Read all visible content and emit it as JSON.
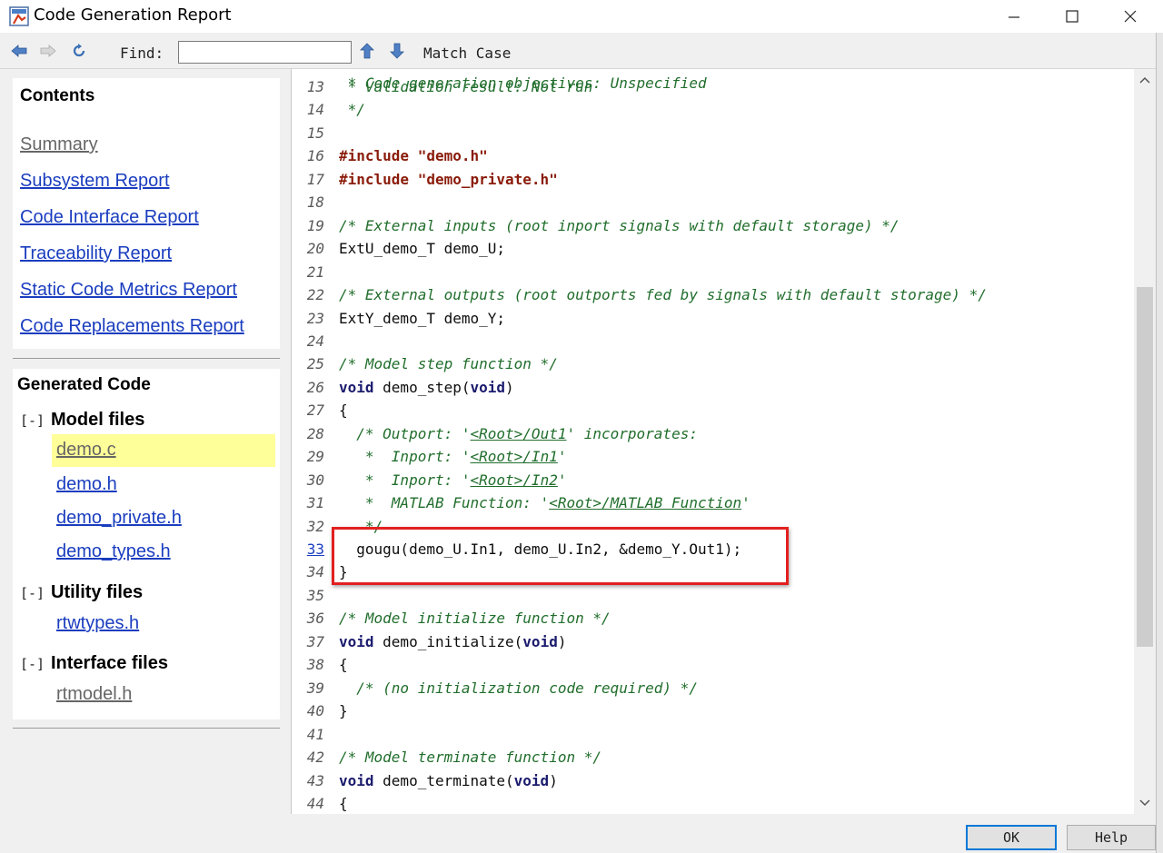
{
  "window": {
    "title": "Code Generation Report"
  },
  "toolbar": {
    "find_label": "Find:",
    "find_value": "",
    "match_case_label": "Match Case"
  },
  "contents": {
    "heading": "Contents",
    "links": [
      {
        "label": "Summary",
        "visited": true
      },
      {
        "label": "Subsystem Report",
        "visited": false
      },
      {
        "label": "Code Interface Report",
        "visited": false
      },
      {
        "label": "Traceability Report",
        "visited": false
      },
      {
        "label": "Static Code Metrics Report",
        "visited": false
      },
      {
        "label": "Code Replacements Report",
        "visited": false
      }
    ]
  },
  "generated": {
    "heading": "Generated Code",
    "groups": [
      {
        "toggle": "[-]",
        "label": "Model files",
        "files": [
          "demo.c",
          "demo.h",
          "demo_private.h",
          "demo_types.h"
        ]
      },
      {
        "toggle": "[-]",
        "label": "Utility files",
        "files": [
          "rtwtypes.h"
        ]
      },
      {
        "toggle": "[-]",
        "label": "Interface files",
        "files": [
          "rtmodel.h"
        ]
      }
    ],
    "selected_file": "demo.c"
  },
  "code_lines": [
    {
      "n": "13",
      "text": " * Validation result: Not run"
    },
    {
      "n": "14",
      "text": " */"
    },
    {
      "n": "15",
      "text": ""
    },
    {
      "n": "16",
      "text": "#include \"demo.h\""
    },
    {
      "n": "17",
      "text": "#include \"demo_private.h\""
    },
    {
      "n": "18",
      "text": ""
    },
    {
      "n": "19",
      "text": "/* External inputs (root inport signals with default storage) */"
    },
    {
      "n": "20",
      "text": "ExtU_demo_T demo_U;"
    },
    {
      "n": "21",
      "text": ""
    },
    {
      "n": "22",
      "text": "/* External outputs (root outports fed by signals with default storage) */"
    },
    {
      "n": "23",
      "text": "ExtY_demo_T demo_Y;"
    },
    {
      "n": "24",
      "text": ""
    },
    {
      "n": "25",
      "text": "/* Model step function */"
    },
    {
      "n": "26",
      "text": "void demo_step(void)"
    },
    {
      "n": "27",
      "text": "{"
    },
    {
      "n": "28",
      "text": "  /* Outport: '<Root>/Out1' incorporates:"
    },
    {
      "n": "29",
      "text": "   *  Inport: '<Root>/In1'"
    },
    {
      "n": "30",
      "text": "   *  Inport: '<Root>/In2'"
    },
    {
      "n": "31",
      "text": "   *  MATLAB Function: '<Root>/MATLAB Function'"
    },
    {
      "n": "32",
      "text": "   */"
    },
    {
      "n": "33",
      "text": "  gougu(demo_U.In1, demo_U.In2, &demo_Y.Out1);"
    },
    {
      "n": "34",
      "text": "}"
    },
    {
      "n": "35",
      "text": ""
    },
    {
      "n": "36",
      "text": "/* Model initialize function */"
    },
    {
      "n": "37",
      "text": "void demo_initialize(void)"
    },
    {
      "n": "38",
      "text": "{"
    },
    {
      "n": "39",
      "text": "  /* (no initialization code required) */"
    },
    {
      "n": "40",
      "text": "}"
    },
    {
      "n": "41",
      "text": ""
    },
    {
      "n": "42",
      "text": "/* Model terminate function */"
    },
    {
      "n": "43",
      "text": "void demo_terminate(void)"
    },
    {
      "n": "44",
      "text": "{"
    }
  ],
  "buttons": {
    "ok": "OK",
    "help": "Help"
  },
  "colors": {
    "link": "#1a3dbf",
    "comment": "#216e2c",
    "preprocessor": "#8a1b0a",
    "keyword": "#1b1b6e",
    "highlight_box": "#e32020",
    "selected_file_bg": "#ffff99"
  }
}
